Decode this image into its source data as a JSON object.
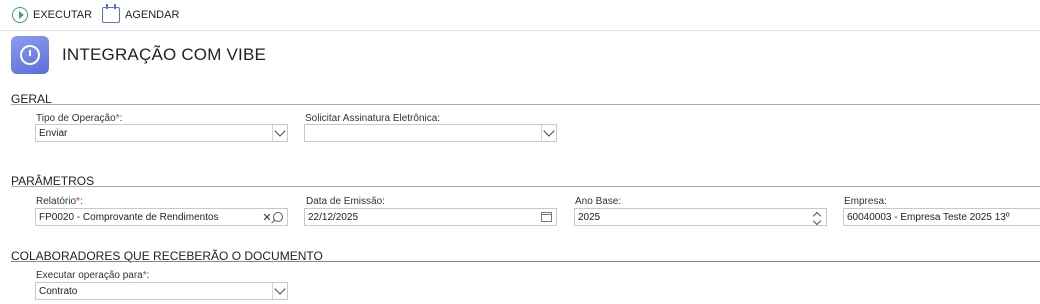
{
  "toolbar": {
    "execute_label": "EXECUTAR",
    "schedule_label": "AGENDAR"
  },
  "page": {
    "title": "INTEGRAÇÃO COM VIBE"
  },
  "geral": {
    "title": "GERAL",
    "tipo_operacao": {
      "label": "Tipo de Operação",
      "required_mark": "*",
      "suffix": ":",
      "value": "Enviar"
    },
    "assinatura": {
      "label": "Solicitar Assinatura Eletrônica:",
      "value": ""
    }
  },
  "parametros": {
    "title": "PARÂMETROS",
    "relatorio": {
      "label": "Relatório",
      "required_mark": "*",
      "suffix": ":",
      "value": "FP0020 - Comprovante de Rendimentos"
    },
    "data_emissao": {
      "label": "Data de Emissão:",
      "value": "22/12/2025"
    },
    "ano_base": {
      "label": "Ano Base:",
      "value": "2025"
    },
    "empresa": {
      "label": "Empresa:",
      "value": "60040003 - Empresa Teste 2025 13º"
    }
  },
  "colaboradores": {
    "title": "COLABORADORES QUE RECEBERÃO O DOCUMENTO",
    "executar_para": {
      "label": "Executar operação para",
      "required_mark": "*",
      "suffix": ":",
      "value": "Contrato"
    }
  },
  "icons": {
    "execute": "play-circle-icon",
    "schedule": "calendar-icon",
    "app": "clock-icon"
  },
  "colors": {
    "execute_green": "#3aa56e",
    "accent_blue": "#5d6fd8",
    "required_red": "#d9261c"
  }
}
